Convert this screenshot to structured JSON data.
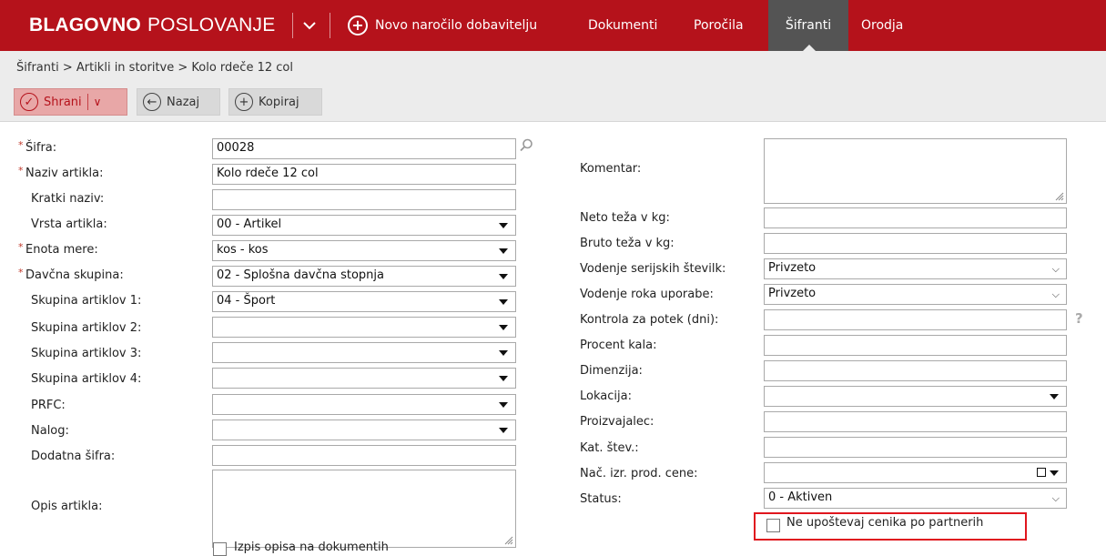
{
  "app": {
    "title_bold": "BLAGOVNO",
    "title_thin": "POSLOVANJE",
    "new_order": "Novo naročilo dobavitelju",
    "nav": [
      "Dokumenti",
      "Poročila",
      "Šifranti",
      "Orodja"
    ],
    "active_nav": "Šifranti"
  },
  "breadcrumb": "Šifranti > Artikli in storitve > Kolo rdeče 12 col",
  "toolbar": {
    "save": "Shrani",
    "back": "Nazaj",
    "copy": "Kopiraj"
  },
  "left": {
    "sifra_label": "Šifra:",
    "sifra_value": "00028",
    "naziv_label": "Naziv artikla:",
    "naziv_value": "Kolo rdeče 12 col",
    "kratki_label": "Kratki naziv:",
    "kratki_value": "",
    "vrsta_label": "Vrsta artikla:",
    "vrsta_value": "00 - Artikel",
    "enota_label": "Enota mere:",
    "enota_value": "kos - kos",
    "davcna_label": "Davčna skupina:",
    "davcna_value": "02 - Splošna davčna stopnja",
    "sk1_label": "Skupina artiklov 1:",
    "sk1_value": "04 - Šport",
    "sk2_label": "Skupina artiklov 2:",
    "sk2_value": "",
    "sk3_label": "Skupina artiklov 3:",
    "sk3_value": "",
    "sk4_label": "Skupina artiklov 4:",
    "sk4_value": "",
    "prfc_label": "PRFC:",
    "prfc_value": "",
    "nalog_label": "Nalog:",
    "nalog_value": "",
    "dodatna_label": "Dodatna šifra:",
    "dodatna_value": "",
    "opis_label": "Opis artikla:",
    "opis_value": "",
    "izpis_label": "Izpis opisa na dokumentih"
  },
  "right": {
    "komentar_label": "Komentar:",
    "neto_label": "Neto teža v kg:",
    "bruto_label": "Bruto teža v kg:",
    "serijske_label": "Vodenje serijskih številk:",
    "serijske_value": "Privzeto",
    "rok_label": "Vodenje roka uporabe:",
    "rok_value": "Privzeto",
    "kontrola_label": "Kontrola za potek (dni):",
    "procent_label": "Procent kala:",
    "dimenzija_label": "Dimenzija:",
    "lokacija_label": "Lokacija:",
    "lokacija_value": "",
    "proizvajalec_label": "Proizvajalec:",
    "kat_label": "Kat. štev.:",
    "nacin_label": "Nač. izr. prod. cene:",
    "nacin_value": "",
    "status_label": "Status:",
    "status_value": "0 - Aktiven",
    "ne_upostevaj_label": "Ne upoštevaj cenika po partnerih",
    "help": "?"
  },
  "colors": {
    "brand_red": "#b5121b",
    "active_nav_bg": "#545454",
    "highlight": "#e0161e"
  }
}
